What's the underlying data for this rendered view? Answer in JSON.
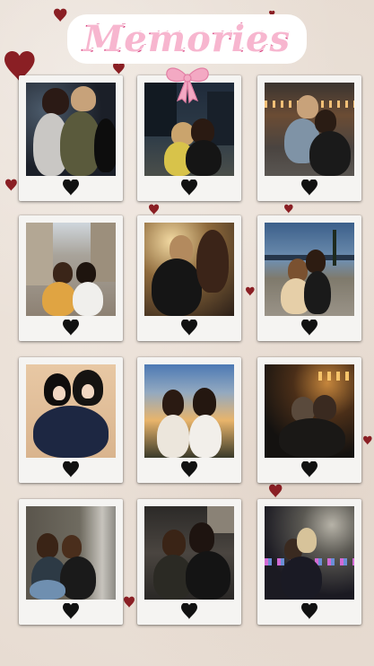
{
  "title": "Memories",
  "colors": {
    "title_fill": "#f7b6cf",
    "title_stroke": "#d6417f",
    "bow": "#f3a9c3",
    "heart": "#111111",
    "scatter_heart": "#8a1f24",
    "frame": "#f5f4f2"
  },
  "polaroids": [
    {
      "scene": "night-city-bokeh",
      "heart_icon": "heart"
    },
    {
      "scene": "night-street-trees",
      "heart_icon": "heart"
    },
    {
      "scene": "night-city-lights",
      "heart_icon": "heart"
    },
    {
      "scene": "day-street-buildings",
      "heart_icon": "heart"
    },
    {
      "scene": "night-car-warm",
      "heart_icon": "heart"
    },
    {
      "scene": "dusk-street-blue",
      "heart_icon": "heart"
    },
    {
      "scene": "indoor-warm-wall",
      "heart_icon": "heart"
    },
    {
      "scene": "sunset-sky",
      "heart_icon": "heart"
    },
    {
      "scene": "night-dark-lights",
      "heart_icon": "heart"
    },
    {
      "scene": "indoor-window",
      "heart_icon": "heart"
    },
    {
      "scene": "night-street-car",
      "heart_icon": "heart"
    },
    {
      "scene": "rainy-night-lights",
      "heart_icon": "heart"
    }
  ]
}
